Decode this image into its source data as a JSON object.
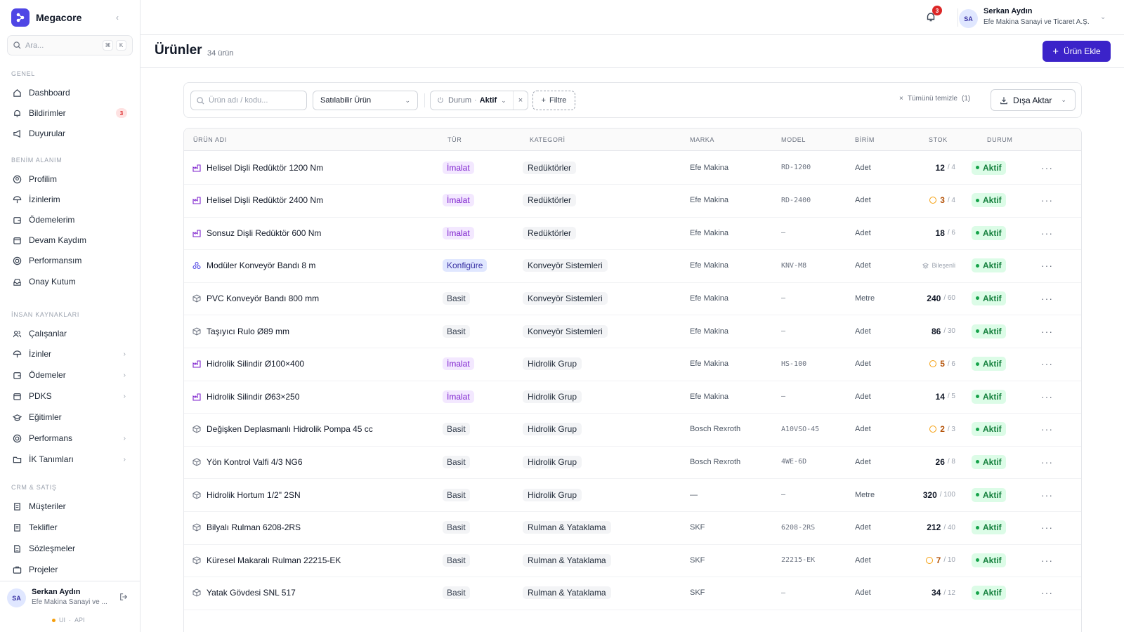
{
  "brand": {
    "name": "Megacore"
  },
  "search": {
    "placeholder": "Ara...",
    "kbd1": "⌘",
    "kbd2": "K"
  },
  "sidebar": {
    "sections": [
      {
        "label": "GENEL"
      },
      {
        "label": "BENİM ALANIM"
      },
      {
        "label": "İNSAN KAYNAKLARI"
      },
      {
        "label": "CRM & SATIŞ"
      }
    ],
    "items": [
      {
        "label": "Dashboard",
        "icon": "home-icon"
      },
      {
        "label": "Bildirimler",
        "icon": "bell-icon",
        "badge": "3"
      },
      {
        "label": "Duyurular",
        "icon": "megaphone-icon"
      },
      {
        "label": "Profilim",
        "icon": "user-circle-icon"
      },
      {
        "label": "İzinlerim",
        "icon": "umbrella-icon"
      },
      {
        "label": "Ödemelerim",
        "icon": "wallet-icon"
      },
      {
        "label": "Devam Kaydım",
        "icon": "calendar-icon"
      },
      {
        "label": "Performansım",
        "icon": "target-icon"
      },
      {
        "label": "Onay Kutum",
        "icon": "inbox-icon"
      },
      {
        "label": "Çalışanlar",
        "icon": "users-icon"
      },
      {
        "label": "İzinler",
        "icon": "umbrella-icon"
      },
      {
        "label": "Ödemeler",
        "icon": "wallet-icon"
      },
      {
        "label": "PDKS",
        "icon": "calendar-icon"
      },
      {
        "label": "Eğitimler",
        "icon": "graduation-cap-icon"
      },
      {
        "label": "Performans",
        "icon": "target-icon"
      },
      {
        "label": "İK Tanımları",
        "icon": "folder-icon"
      },
      {
        "label": "Müşteriler",
        "icon": "building-icon"
      },
      {
        "label": "Teklifler",
        "icon": "receipt-icon"
      },
      {
        "label": "Sözleşmeler",
        "icon": "document-icon"
      },
      {
        "label": "Projeler",
        "icon": "briefcase-icon"
      }
    ]
  },
  "footer_user": {
    "initials": "SA",
    "name": "Serkan Aydın",
    "org": "Efe Makina Sanayi ve ...",
    "status_ui": "UI",
    "status_api": "API"
  },
  "topbar": {
    "notif_count": "3",
    "initials": "SA",
    "name": "Serkan Aydın",
    "org": "Efe Makina Sanayi ve Ticaret A.Ş."
  },
  "page": {
    "title": "Ürünler",
    "count": "34 ürün",
    "add_label": "Ürün Ekle"
  },
  "filters": {
    "search_placeholder": "Ürün adı / kodu...",
    "type_select": "Satılabilir Ürün",
    "chip_label": "Durum",
    "chip_value": "Aktif",
    "add_filter": "Filtre",
    "clear_all": "Tümünü temizle",
    "clear_count": "(1)",
    "export": "Dışa Aktar"
  },
  "table": {
    "columns": [
      "ÜRÜN ADI",
      "TÜR",
      "KATEGORİ",
      "MARKA",
      "MODEL",
      "BİRİM",
      "STOK",
      "DURUM"
    ],
    "rows": [
      {
        "name": "Helisel Dişli Redüktör 1200 Nm",
        "icon": "factory-icon",
        "type": "İmalat",
        "category": "Redüktörler",
        "brand": "Efe Makina",
        "model": "RD-1200",
        "unit": "Adet",
        "stock": "12",
        "min": "/ 4",
        "low": false,
        "status": "Aktif"
      },
      {
        "name": "Helisel Dişli Redüktör 2400 Nm",
        "icon": "factory-icon",
        "type": "İmalat",
        "category": "Redüktörler",
        "brand": "Efe Makina",
        "model": "RD-2400",
        "unit": "Adet",
        "stock": "3",
        "min": "/ 4",
        "low": true,
        "status": "Aktif"
      },
      {
        "name": "Sonsuz Dişli Redüktör 600 Nm",
        "icon": "factory-icon",
        "type": "İmalat",
        "category": "Redüktörler",
        "brand": "Efe Makina",
        "model": "—",
        "unit": "Adet",
        "stock": "18",
        "min": "/ 6",
        "low": false,
        "status": "Aktif"
      },
      {
        "name": "Modüler Konveyör Bandı 8 m",
        "icon": "components-icon",
        "type": "Konfigüre",
        "category": "Konveyör Sistemleri",
        "brand": "Efe Makina",
        "model": "KNV-M8",
        "unit": "Adet",
        "stock": "",
        "min": "",
        "bundle": "Bileşenli",
        "low": false,
        "status": "Aktif"
      },
      {
        "name": "PVC Konveyör Bandı 800 mm",
        "icon": "box-icon",
        "type": "Basit",
        "category": "Konveyör Sistemleri",
        "brand": "Efe Makina",
        "model": "—",
        "unit": "Metre",
        "stock": "240",
        "min": "/ 60",
        "low": false,
        "status": "Aktif"
      },
      {
        "name": "Taşıyıcı Rulo Ø89 mm",
        "icon": "box-icon",
        "type": "Basit",
        "category": "Konveyör Sistemleri",
        "brand": "Efe Makina",
        "model": "—",
        "unit": "Adet",
        "stock": "86",
        "min": "/ 30",
        "low": false,
        "status": "Aktif"
      },
      {
        "name": "Hidrolik Silindir Ø100×400",
        "icon": "factory-icon",
        "type": "İmalat",
        "category": "Hidrolik Grup",
        "brand": "Efe Makina",
        "model": "HS-100",
        "unit": "Adet",
        "stock": "5",
        "min": "/ 6",
        "low": true,
        "status": "Aktif"
      },
      {
        "name": "Hidrolik Silindir Ø63×250",
        "icon": "factory-icon",
        "type": "İmalat",
        "category": "Hidrolik Grup",
        "brand": "Efe Makina",
        "model": "—",
        "unit": "Adet",
        "stock": "14",
        "min": "/ 5",
        "low": false,
        "status": "Aktif"
      },
      {
        "name": "Değişken Deplasmanlı Hidrolik Pompa 45 cc",
        "icon": "box-icon",
        "type": "Basit",
        "category": "Hidrolik Grup",
        "brand": "Bosch Rexroth",
        "model": "A10VSO-45",
        "unit": "Adet",
        "stock": "2",
        "min": "/ 3",
        "low": true,
        "status": "Aktif"
      },
      {
        "name": "Yön Kontrol Valfi 4/3 NG6",
        "icon": "box-icon",
        "type": "Basit",
        "category": "Hidrolik Grup",
        "brand": "Bosch Rexroth",
        "model": "4WE-6D",
        "unit": "Adet",
        "stock": "26",
        "min": "/ 8",
        "low": false,
        "status": "Aktif"
      },
      {
        "name": "Hidrolik Hortum 1/2\" 2SN",
        "icon": "box-icon",
        "type": "Basit",
        "category": "Hidrolik Grup",
        "brand": "—",
        "model": "—",
        "unit": "Metre",
        "stock": "320",
        "min": "/ 100",
        "low": false,
        "status": "Aktif"
      },
      {
        "name": "Bilyalı Rulman 6208-2RS",
        "icon": "box-icon",
        "type": "Basit",
        "category": "Rulman & Yataklama",
        "brand": "SKF",
        "model": "6208-2RS",
        "unit": "Adet",
        "stock": "212",
        "min": "/ 40",
        "low": false,
        "status": "Aktif"
      },
      {
        "name": "Küresel Makaralı Rulman 22215-EK",
        "icon": "box-icon",
        "type": "Basit",
        "category": "Rulman & Yataklama",
        "brand": "SKF",
        "model": "22215-EK",
        "unit": "Adet",
        "stock": "7",
        "min": "/ 10",
        "low": true,
        "status": "Aktif"
      },
      {
        "name": "Yatak Gövdesi SNL 517",
        "icon": "box-icon",
        "type": "Basit",
        "category": "Rulman & Yataklama",
        "brand": "SKF",
        "model": "—",
        "unit": "Adet",
        "stock": "34",
        "min": "/ 12",
        "low": false,
        "status": "Aktif"
      }
    ]
  },
  "colors": {
    "accent": "#3b23c9",
    "status_green": "#15803d",
    "warn": "#f59e0b",
    "imalat": "#7e22ce"
  }
}
